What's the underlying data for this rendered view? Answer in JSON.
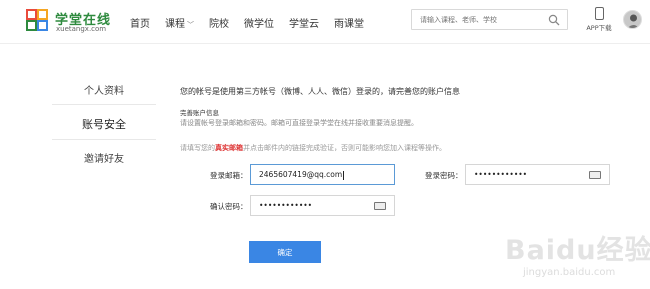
{
  "header": {
    "logo_title": "学堂在线",
    "logo_sub": "xuetangx.com",
    "nav": [
      {
        "label": "首页"
      },
      {
        "label": "课程",
        "dropdown": true
      },
      {
        "label": "院校"
      },
      {
        "label": "微学位"
      },
      {
        "label": "学堂云"
      },
      {
        "label": "雨课堂"
      }
    ],
    "search_placeholder": "请输入课程、老师、学校",
    "app_label": "APP下载"
  },
  "sidebar": {
    "items": [
      {
        "label": "个人资料"
      },
      {
        "label": "账号安全",
        "active": true
      },
      {
        "label": "邀请好友"
      }
    ]
  },
  "main": {
    "title": "您的帐号是使用第三方帐号（微博、人人、微信）登录的，请完善您的账户信息",
    "section_title": "完善账户信息",
    "section_desc": "请设置帐号登录邮箱和密码。邮箱可直接登录学堂在线并接收重要消息提醒。",
    "note_prefix": "请填写您的",
    "note_highlight": "真实邮箱",
    "note_suffix": "并点击邮件内的链接完成验证，否则可能影响您加入课程等操作。",
    "email_label": "登录邮箱：",
    "email_value": "2465607419@qq.com",
    "password_label": "登录密码：",
    "password_value": "••••••••••••",
    "confirm_label": "确认密码：",
    "confirm_value": "••••••••••••",
    "submit_label": "确定"
  },
  "watermark": {
    "text": "Baidu经验",
    "url": "jingyan.baidu.com"
  },
  "colors": {
    "accent": "#3a86e4",
    "brand": "#2e8a3e",
    "highlight": "#dd3333"
  }
}
